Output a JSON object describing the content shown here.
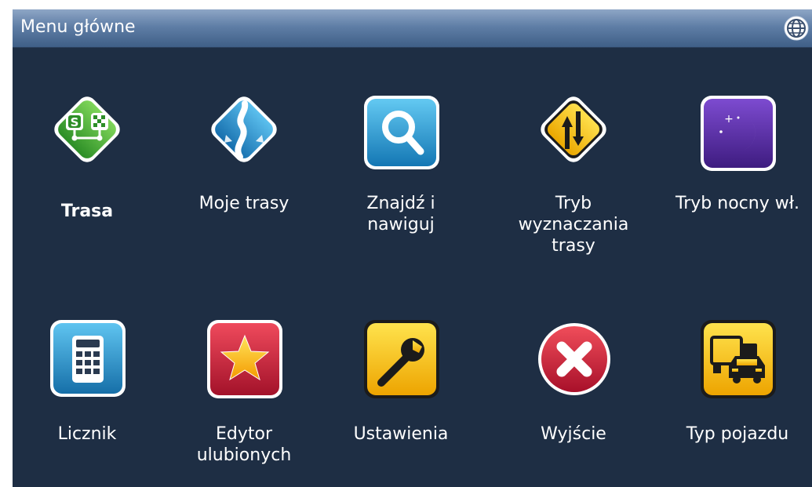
{
  "header": {
    "title": "Menu główne",
    "icon": "globe-icon"
  },
  "menu": {
    "items": [
      {
        "label": "Trasa",
        "icon": "route-flags-icon",
        "bold": true
      },
      {
        "label": "Moje trasy",
        "icon": "winding-road-icon"
      },
      {
        "label": "Znajdź i\nnawiguj",
        "icon": "magnifier-icon"
      },
      {
        "label": "Tryb\nwyznaczania\ntrasy",
        "icon": "two-lanes-sign-icon"
      },
      {
        "label": "Tryb nocny wł.",
        "icon": "moon-icon"
      },
      {
        "label": "Licznik",
        "icon": "calculator-icon"
      },
      {
        "label": "Edytor\nulubionych",
        "icon": "star-icon"
      },
      {
        "label": "Ustawienia",
        "icon": "wrench-icon"
      },
      {
        "label": "Wyjście",
        "icon": "exit-x-icon"
      },
      {
        "label": "Typ pojazdu",
        "icon": "vehicle-icon"
      }
    ]
  },
  "colors": {
    "background": "#1e2e44",
    "titlebar": "#5f7ea6",
    "green": "#3fae3a",
    "blue": "#1c8fd0",
    "yellow": "#f4c20d",
    "purple": "#5a2ea0",
    "red": "#d3263a"
  }
}
